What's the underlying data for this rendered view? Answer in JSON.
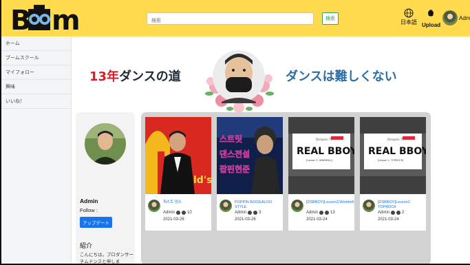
{
  "header": {
    "logo_text": "Boom",
    "search_placeholder": "検索",
    "search_button": "検索",
    "language_label": "日本語",
    "upload_label": "Upload",
    "user_name": "Admin",
    "accent_color": "#ffdb4d"
  },
  "sidebar": {
    "items": [
      {
        "label": "ホーム"
      },
      {
        "label": "ブームスクール"
      },
      {
        "label": "マイフォロー"
      },
      {
        "label": "興味"
      },
      {
        "label": "いいね！"
      }
    ]
  },
  "banner": {
    "left_number": "13年",
    "left_text": "ダンスの道",
    "right_text": "ダンスは難しくない"
  },
  "profile": {
    "name": "Admin",
    "follow": "Follow :",
    "update_button": "アップデート",
    "intro_title": "紹介",
    "intro_text": "こんにちは。プロダンサーチムドンスと申しま"
  },
  "videos": [
    {
      "title": "퍼스트 댄스",
      "author": "Admin",
      "views": "10",
      "date": "2021-03-26"
    },
    {
      "title": "POPPIN BOOGALOO STYLE",
      "author": "Admin",
      "views": "3",
      "date": "2021-03-26"
    },
    {
      "title": "[DSBBOY]Lesson3.Windmill",
      "author": "Admin",
      "views": "13",
      "date": "2021-03-24"
    },
    {
      "title": "[DSBBOY]Lesson2. TOPROCK",
      "author": "Admin",
      "views": "2",
      "date": "2021-03-24"
    }
  ],
  "thumbnails": {
    "video2_overlay": "스트릿 댄스전설 팝핀현준",
    "video3_brand": "REAL BBOY",
    "video3_sub": "[Lesson 3. WINDMILL]",
    "video4_brand": "REAL BBOY",
    "video4_sub": "[Lesson 2. TOPROCK]",
    "small_tag": "Dongsoo TV",
    "logo_partial": "ld's"
  }
}
